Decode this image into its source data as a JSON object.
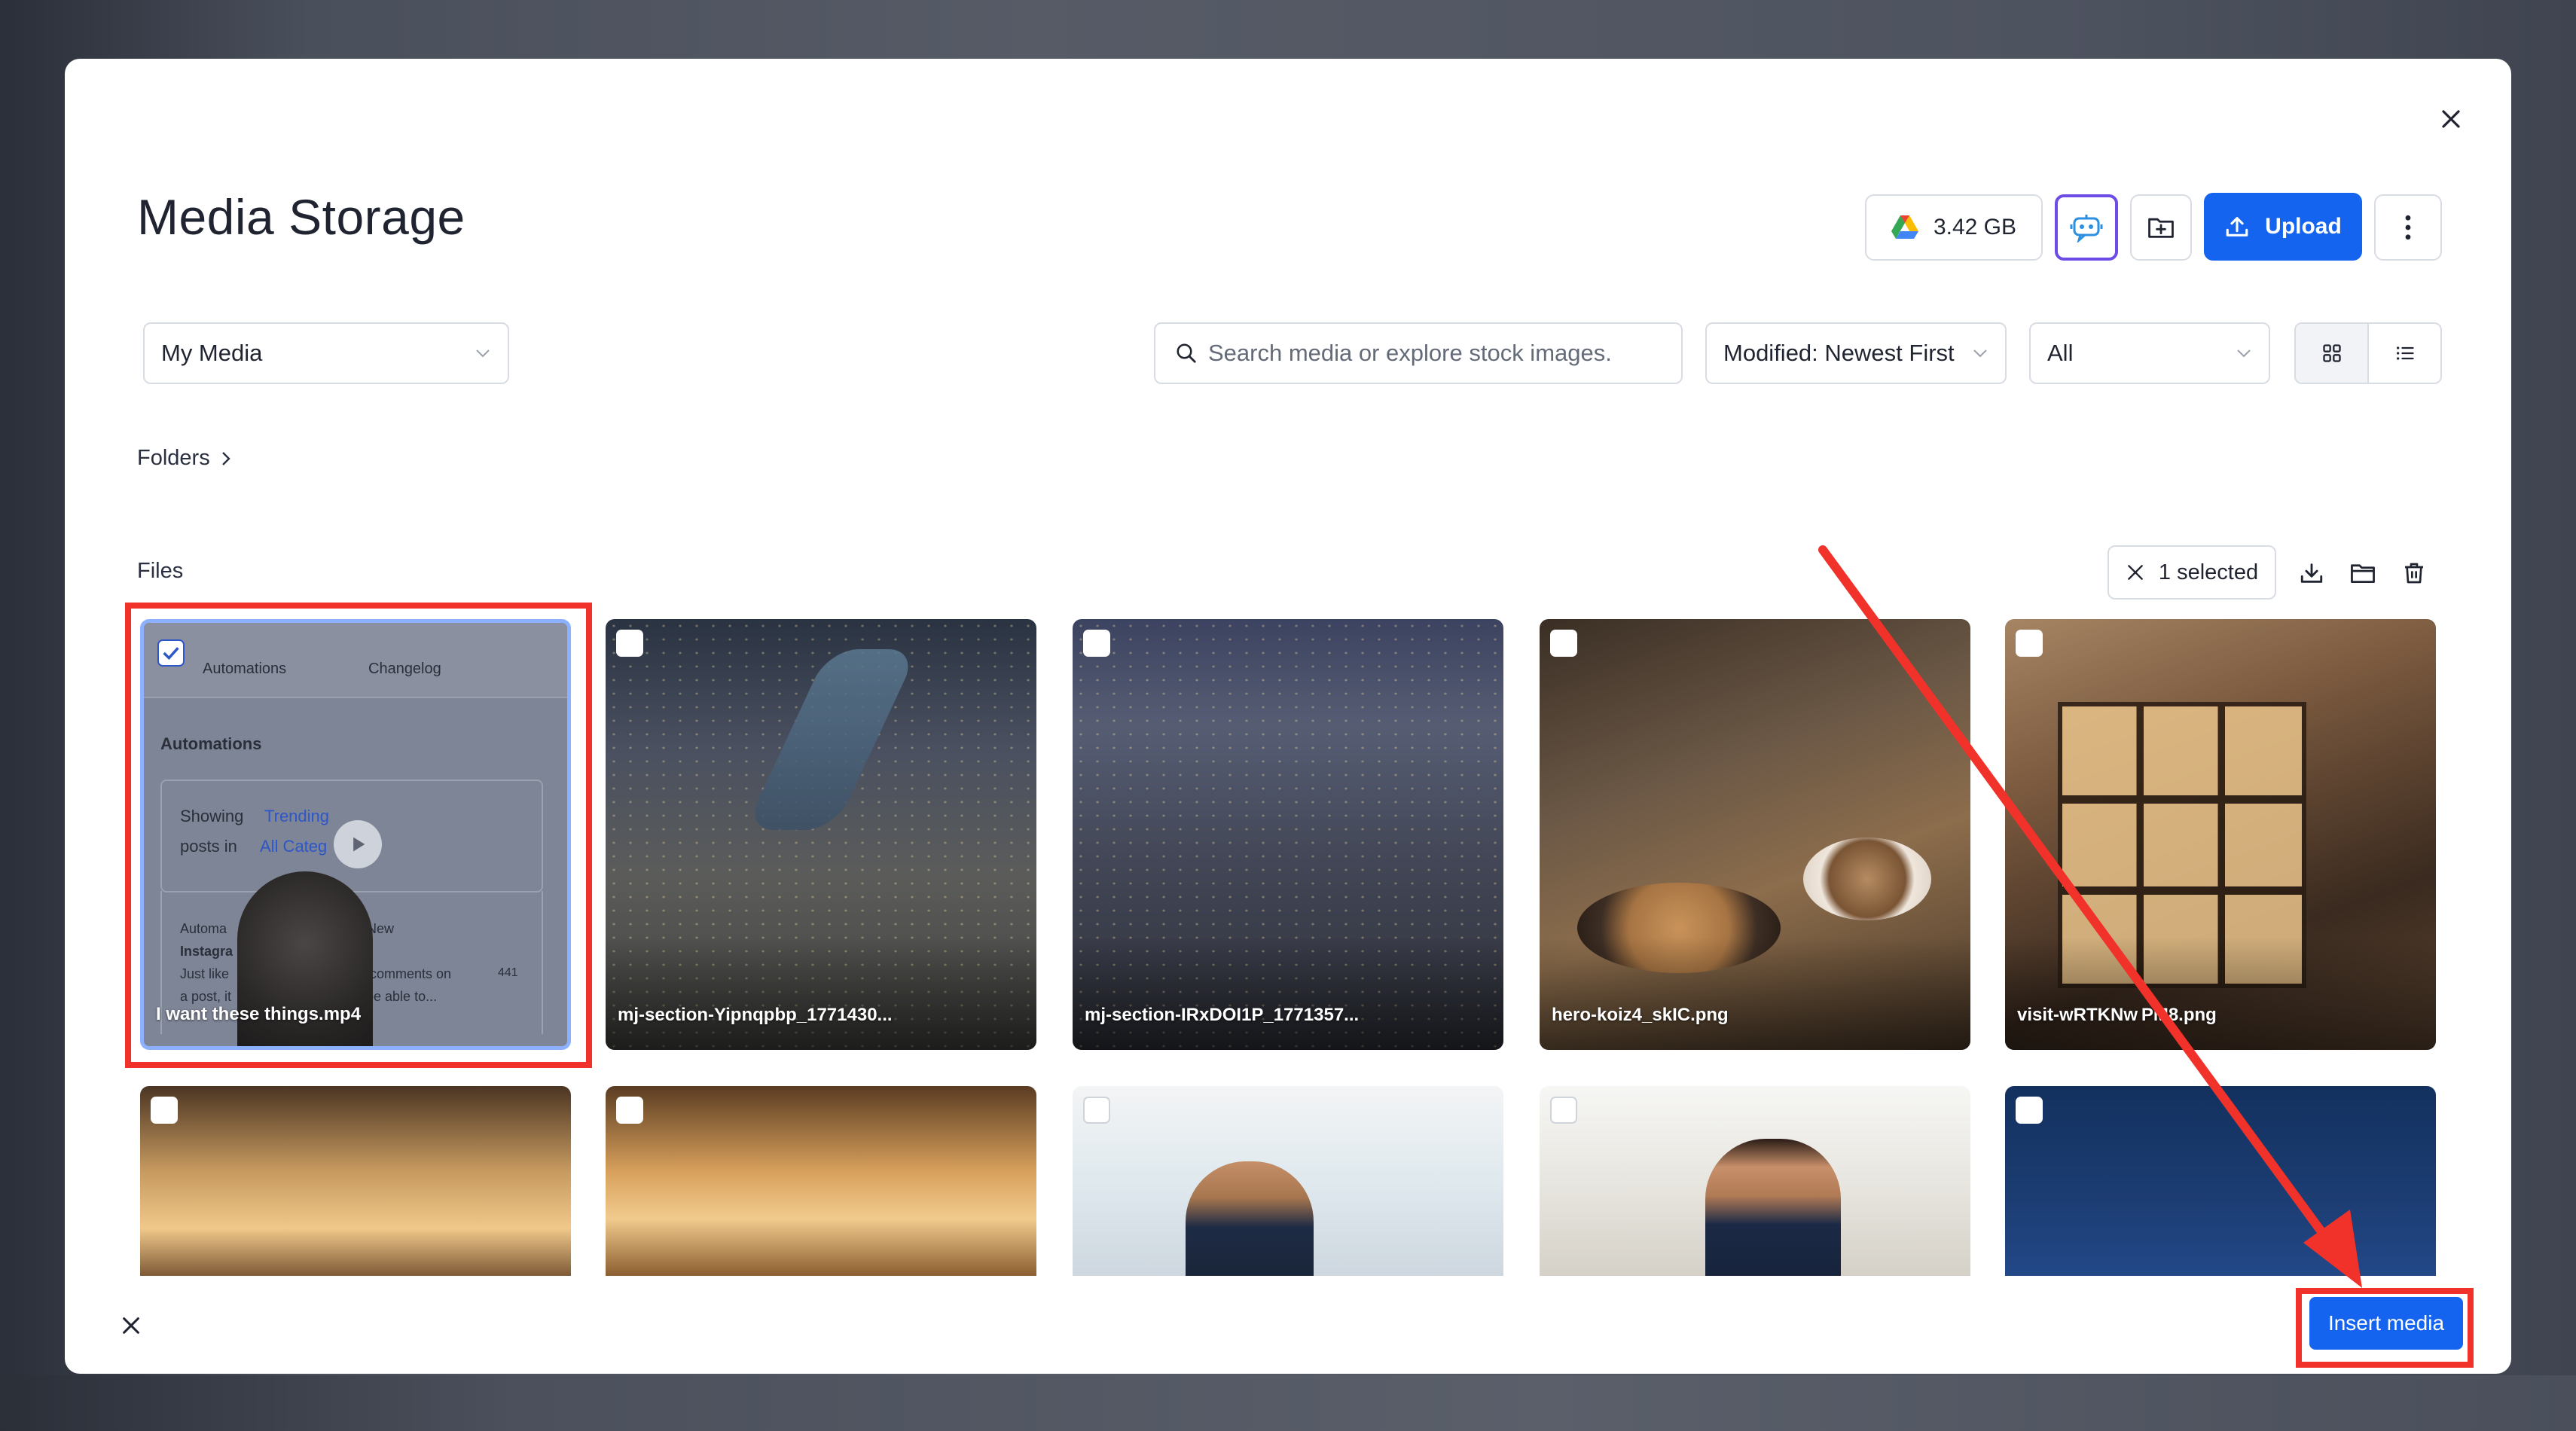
{
  "header": {
    "title": "Media Storage",
    "storage_label": "3.42 GB",
    "upload_label": "Upload"
  },
  "toolbar": {
    "library_select": "My Media",
    "search_placeholder": "Search media or explore stock images.",
    "sort_select": "Modified: Newest First",
    "filter_select": "All"
  },
  "sections": {
    "folders_label": "Folders",
    "files_label": "Files",
    "selected_label": "1 selected"
  },
  "video_preview": {
    "tab_automations": "Automations",
    "tab_changelog": "Changelog",
    "heading": "Automations",
    "showing": "Showing",
    "trending": "Trending",
    "posts_in": "posts in",
    "all_categories": "All Categ",
    "snippet_title": "Automa",
    "snippet_new": "New",
    "snippet_sub": "Instagra",
    "snippet_body1": "Just like",
    "snippet_body2": "comments on",
    "snippet_body3": "a post, it",
    "snippet_body4": "o be able to...",
    "count": "441"
  },
  "files": [
    {
      "name": "I want these things.mp4",
      "selected": true
    },
    {
      "name": "mj-section-Yipnqpbp_1771430...",
      "selected": false
    },
    {
      "name": "mj-section-IRxDOI1P_1771357...",
      "selected": false
    },
    {
      "name": "hero-koiz4_skIC.png",
      "selected": false
    },
    {
      "name": "visit-wRTKNw PM8.png",
      "selected": false
    },
    {
      "name": "",
      "selected": false
    },
    {
      "name": "",
      "selected": false
    },
    {
      "name": "",
      "selected": false
    },
    {
      "name": "",
      "selected": false
    },
    {
      "name": "",
      "selected": false
    }
  ],
  "footer": {
    "insert_label": "Insert media"
  },
  "icons": {
    "close": "close-icon",
    "drive": "google-drive-icon",
    "ai": "ai-assistant-icon",
    "new_folder": "new-folder-icon",
    "upload": "upload-icon",
    "more": "more-vertical-icon",
    "search": "search-icon",
    "grid": "grid-view-icon",
    "list": "list-view-icon",
    "download": "download-icon",
    "folder": "folder-icon",
    "trash": "trash-icon",
    "play": "play-icon"
  },
  "colors": {
    "primary": "#1464f0",
    "annotation": "#f0322a",
    "ai_border": "#6d4ce8"
  }
}
